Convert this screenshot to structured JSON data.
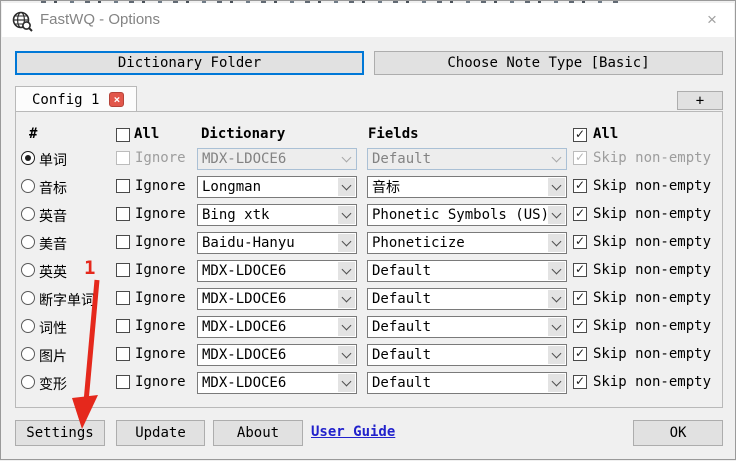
{
  "window": {
    "title": "FastWQ - Options",
    "close_glyph": "×"
  },
  "toolbar": {
    "dictionary_folder": "Dictionary Folder",
    "choose_note_type": "Choose Note Type [Basic]"
  },
  "tabs": {
    "config_tab": "Config 1",
    "add_tab": "+"
  },
  "table": {
    "headers": {
      "num": "#",
      "all_ignore": "All",
      "dictionary": "Dictionary",
      "fields": "Fields",
      "all_skip": "All"
    },
    "ignore_label": "Ignore",
    "skip_label": "Skip non-empty",
    "rows": [
      {
        "label": "单词",
        "dict": "MDX-LDOCE6",
        "field": "Default",
        "selected": true,
        "disabled": true
      },
      {
        "label": "音标",
        "dict": "Longman",
        "field": "音标"
      },
      {
        "label": "英音",
        "dict": "Bing xtk",
        "field": "Phonetic Symbols (US)"
      },
      {
        "label": "美音",
        "dict": "Baidu-Hanyu",
        "field": "Phoneticize"
      },
      {
        "label": "英英",
        "dict": "MDX-LDOCE6",
        "field": "Default",
        "annotation": "1"
      },
      {
        "label": "断字单词",
        "dict": "MDX-LDOCE6",
        "field": "Default"
      },
      {
        "label": "词性",
        "dict": "MDX-LDOCE6",
        "field": "Default"
      },
      {
        "label": "图片",
        "dict": "MDX-LDOCE6",
        "field": "Default"
      },
      {
        "label": "变形",
        "dict": "MDX-LDOCE6",
        "field": "Default"
      }
    ]
  },
  "footer": {
    "settings": "Settings",
    "update": "Update",
    "about": "About",
    "user_guide": "User Guide",
    "ok": "OK"
  },
  "annotation": {
    "step_number": "1"
  },
  "colors": {
    "accent_blue": "#0078d7",
    "annotation_red": "#e5281c",
    "link_blue": "#2222cc",
    "tab_close_red": "#e2574b"
  }
}
